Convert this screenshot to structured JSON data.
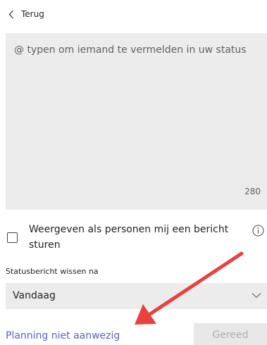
{
  "header": {
    "back_label": "Terug"
  },
  "status": {
    "placeholder": "@ typen om iemand te vermelden in uw status",
    "char_count": "280"
  },
  "show_when_messaging": {
    "label": "Weergeven als personen mij een bericht sturen",
    "checked": false
  },
  "clear_after": {
    "label": "Statusbericht wissen na",
    "selected": "Vandaag"
  },
  "footer": {
    "schedule_link": "Planning niet aanwezig",
    "done_label": "Gereed"
  },
  "colors": {
    "link": "#5b5fc7",
    "annotation_arrow": "#e8413e",
    "field_bg": "#ececec"
  },
  "icons": [
    "chevron-left-icon",
    "info-icon",
    "chevron-down-icon"
  ]
}
